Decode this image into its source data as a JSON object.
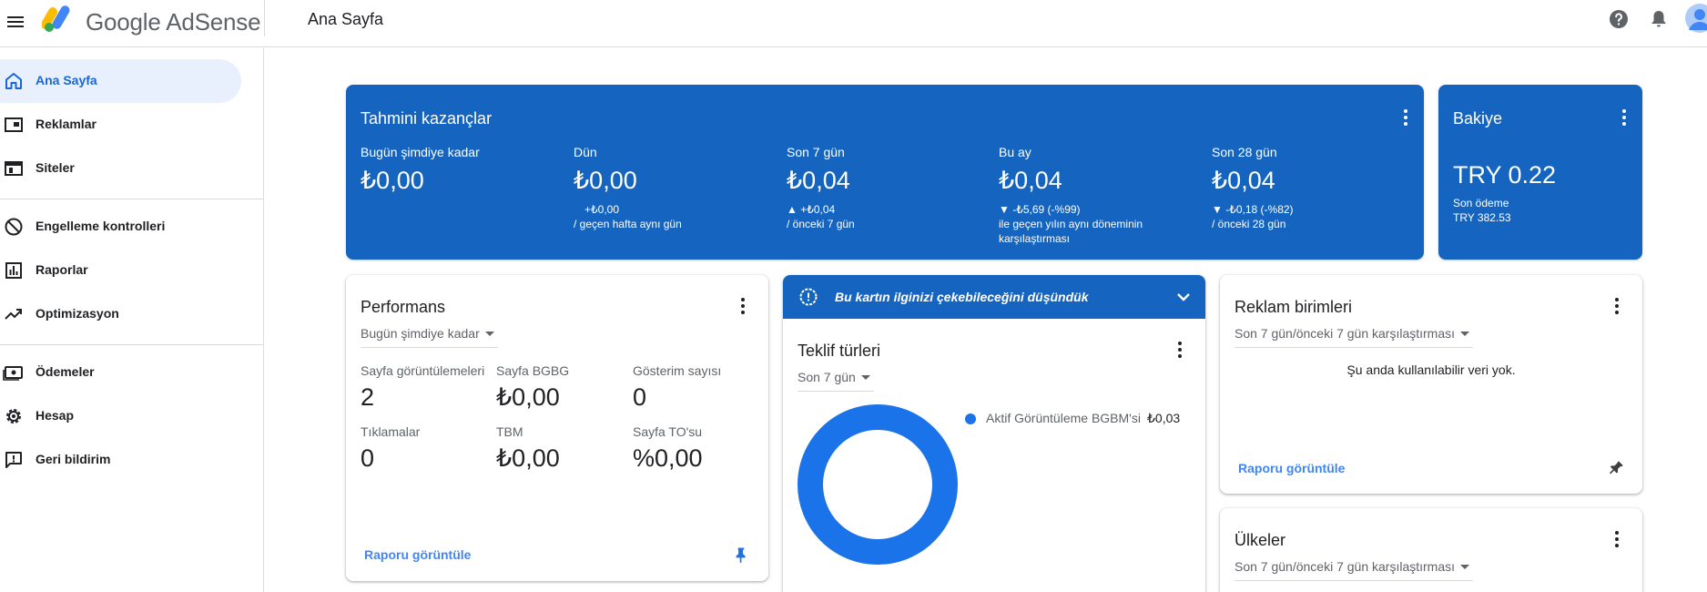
{
  "app": {
    "brand_google": "Google",
    "brand_product": "AdSense",
    "page_title": "Ana Sayfa"
  },
  "colors": {
    "accent": "#1565c0",
    "link": "#4285f4",
    "active_nav_bg": "#e8f0fe",
    "donut": "#1a73e8"
  },
  "sidebar": {
    "items": [
      {
        "label": "Ana Sayfa",
        "icon": "home-icon",
        "active": true
      },
      {
        "label": "Reklamlar",
        "icon": "ads-icon"
      },
      {
        "label": "Siteler",
        "icon": "sites-icon"
      },
      {
        "label": "Engelleme kontrolleri",
        "icon": "block-icon"
      },
      {
        "label": "Raporlar",
        "icon": "reports-icon"
      },
      {
        "label": "Optimizasyon",
        "icon": "trending-up-icon"
      },
      {
        "label": "Ödemeler",
        "icon": "payments-icon"
      },
      {
        "label": "Hesap",
        "icon": "gear-icon"
      },
      {
        "label": "Geri bildirim",
        "icon": "feedback-icon"
      }
    ]
  },
  "earnings": {
    "title": "Tahmini kazançlar",
    "stats": [
      {
        "label": "Bugün şimdiye kadar",
        "value": "₺0,00",
        "delta": "",
        "delta_sub": ""
      },
      {
        "label": "Dün",
        "value": "₺0,00",
        "delta": "+₺0,00",
        "delta_sub": "/ geçen hafta aynı gün"
      },
      {
        "label": "Son 7 gün",
        "value": "₺0,04",
        "delta": "▲ +₺0,04",
        "delta_sub": "/ önceki 7 gün"
      },
      {
        "label": "Bu ay",
        "value": "₺0,04",
        "delta": "▼ -₺5,69 (-%99)",
        "delta_sub": "ile geçen yılın aynı döneminin",
        "delta_sub2": "karşılaştırması"
      },
      {
        "label": "Son 28 gün",
        "value": "₺0,04",
        "delta": "▼ -₺0,18 (-%82)",
        "delta_sub": "/ önceki 28 gün"
      }
    ]
  },
  "balance": {
    "title": "Bakiye",
    "value": "TRY 0.22",
    "last_payment_label": "Son ödeme",
    "last_payment_value": "TRY 382.53"
  },
  "performance": {
    "title": "Performans",
    "period": "Bugün şimdiye kadar",
    "metrics": [
      {
        "label": "Sayfa görüntülemeleri",
        "value": "2"
      },
      {
        "label": "Sayfa BGBG",
        "value": "₺0,00"
      },
      {
        "label": "Gösterim sayısı",
        "value": "0"
      },
      {
        "label": "Tıklamalar",
        "value": "0"
      },
      {
        "label": "TBM",
        "value": "₺0,00"
      },
      {
        "label": "Sayfa TO'su",
        "value": "%0,00"
      }
    ],
    "link": "Raporu görüntüle"
  },
  "suggestion": {
    "banner": "Bu kartın ilginizi çekebileceğini düşündük",
    "title": "Teklif türleri",
    "period": "Son 7 gün",
    "legend_label": "Aktif Görüntüleme BGBM'si",
    "legend_value": "₺0,03"
  },
  "chart_data": {
    "type": "pie",
    "categories": [
      "Aktif Görüntüleme BGBM'si"
    ],
    "values": [
      0.03
    ],
    "title": "Teklif türleri",
    "legend": "right"
  },
  "ad_units": {
    "title": "Reklam birimleri",
    "period": "Son 7 gün/önceki 7 gün karşılaştırması",
    "empty": "Şu anda kullanılabilir veri yok.",
    "link": "Raporu görüntüle"
  },
  "countries": {
    "title": "Ülkeler",
    "period": "Son 7 gün/önceki 7 gün karşılaştırması"
  }
}
